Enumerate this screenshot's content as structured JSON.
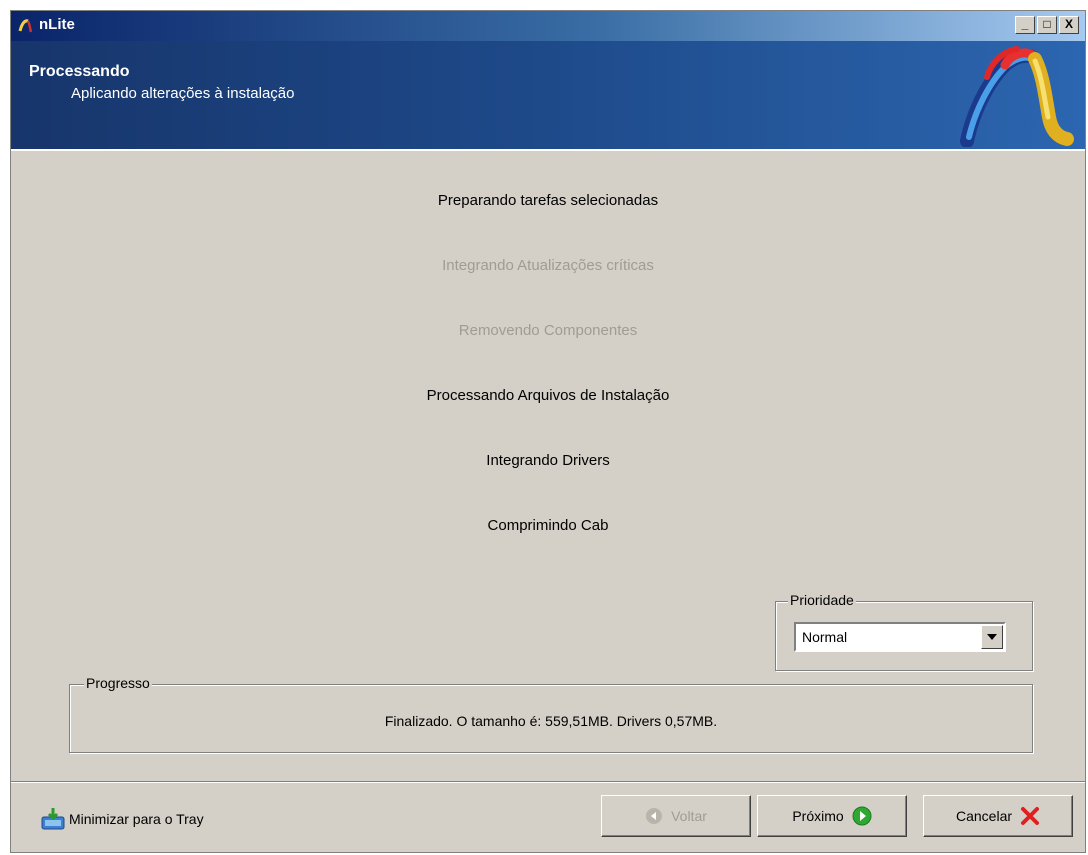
{
  "window": {
    "title": "nLite",
    "minimize_label": "_",
    "maximize_label": "□",
    "close_label": "X"
  },
  "header": {
    "title": "Processando",
    "subtitle": "Aplicando alterações à instalação"
  },
  "tasks": [
    {
      "label": "Preparando tarefas selecionadas",
      "state": "active"
    },
    {
      "label": "Integrando Atualizações críticas",
      "state": "skipped"
    },
    {
      "label": "Removendo Componentes",
      "state": "skipped"
    },
    {
      "label": "Processando Arquivos de Instalação",
      "state": "active"
    },
    {
      "label": "Integrando Drivers",
      "state": "active"
    },
    {
      "label": "Comprimindo Cab",
      "state": "active"
    }
  ],
  "priority": {
    "label": "Prioridade",
    "value": "Normal"
  },
  "progress": {
    "label": "Progresso",
    "text": "Finalizado. O tamanho é: 559,51MB. Drivers 0,57MB."
  },
  "footer": {
    "tray_label": "Minimizar para o Tray",
    "back_label": "Voltar",
    "next_label": "Próximo",
    "cancel_label": "Cancelar"
  },
  "icons": {
    "app": "nlite-logo-icon",
    "tray": "tray-icon",
    "back": "back-arrow-icon",
    "next": "next-arrow-icon",
    "cancel": "red-x-icon",
    "dropdown": "dropdown-arrow-icon"
  },
  "colors": {
    "banner": "#1e4a8a",
    "dialog": "#d4d0c8",
    "dim_text": "#a09c94",
    "next_green": "#2fa832",
    "cancel_red": "#e02020"
  }
}
